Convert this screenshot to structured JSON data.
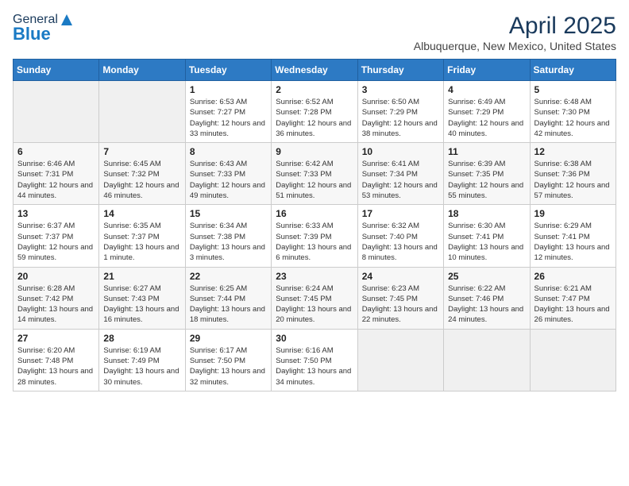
{
  "header": {
    "logo_general": "General",
    "logo_blue": "Blue",
    "title": "April 2025",
    "subtitle": "Albuquerque, New Mexico, United States"
  },
  "weekdays": [
    "Sunday",
    "Monday",
    "Tuesday",
    "Wednesday",
    "Thursday",
    "Friday",
    "Saturday"
  ],
  "weeks": [
    [
      {
        "day": "",
        "info": ""
      },
      {
        "day": "",
        "info": ""
      },
      {
        "day": "1",
        "info": "Sunrise: 6:53 AM\nSunset: 7:27 PM\nDaylight: 12 hours and 33 minutes."
      },
      {
        "day": "2",
        "info": "Sunrise: 6:52 AM\nSunset: 7:28 PM\nDaylight: 12 hours and 36 minutes."
      },
      {
        "day": "3",
        "info": "Sunrise: 6:50 AM\nSunset: 7:29 PM\nDaylight: 12 hours and 38 minutes."
      },
      {
        "day": "4",
        "info": "Sunrise: 6:49 AM\nSunset: 7:29 PM\nDaylight: 12 hours and 40 minutes."
      },
      {
        "day": "5",
        "info": "Sunrise: 6:48 AM\nSunset: 7:30 PM\nDaylight: 12 hours and 42 minutes."
      }
    ],
    [
      {
        "day": "6",
        "info": "Sunrise: 6:46 AM\nSunset: 7:31 PM\nDaylight: 12 hours and 44 minutes."
      },
      {
        "day": "7",
        "info": "Sunrise: 6:45 AM\nSunset: 7:32 PM\nDaylight: 12 hours and 46 minutes."
      },
      {
        "day": "8",
        "info": "Sunrise: 6:43 AM\nSunset: 7:33 PM\nDaylight: 12 hours and 49 minutes."
      },
      {
        "day": "9",
        "info": "Sunrise: 6:42 AM\nSunset: 7:33 PM\nDaylight: 12 hours and 51 minutes."
      },
      {
        "day": "10",
        "info": "Sunrise: 6:41 AM\nSunset: 7:34 PM\nDaylight: 12 hours and 53 minutes."
      },
      {
        "day": "11",
        "info": "Sunrise: 6:39 AM\nSunset: 7:35 PM\nDaylight: 12 hours and 55 minutes."
      },
      {
        "day": "12",
        "info": "Sunrise: 6:38 AM\nSunset: 7:36 PM\nDaylight: 12 hours and 57 minutes."
      }
    ],
    [
      {
        "day": "13",
        "info": "Sunrise: 6:37 AM\nSunset: 7:37 PM\nDaylight: 12 hours and 59 minutes."
      },
      {
        "day": "14",
        "info": "Sunrise: 6:35 AM\nSunset: 7:37 PM\nDaylight: 13 hours and 1 minute."
      },
      {
        "day": "15",
        "info": "Sunrise: 6:34 AM\nSunset: 7:38 PM\nDaylight: 13 hours and 3 minutes."
      },
      {
        "day": "16",
        "info": "Sunrise: 6:33 AM\nSunset: 7:39 PM\nDaylight: 13 hours and 6 minutes."
      },
      {
        "day": "17",
        "info": "Sunrise: 6:32 AM\nSunset: 7:40 PM\nDaylight: 13 hours and 8 minutes."
      },
      {
        "day": "18",
        "info": "Sunrise: 6:30 AM\nSunset: 7:41 PM\nDaylight: 13 hours and 10 minutes."
      },
      {
        "day": "19",
        "info": "Sunrise: 6:29 AM\nSunset: 7:41 PM\nDaylight: 13 hours and 12 minutes."
      }
    ],
    [
      {
        "day": "20",
        "info": "Sunrise: 6:28 AM\nSunset: 7:42 PM\nDaylight: 13 hours and 14 minutes."
      },
      {
        "day": "21",
        "info": "Sunrise: 6:27 AM\nSunset: 7:43 PM\nDaylight: 13 hours and 16 minutes."
      },
      {
        "day": "22",
        "info": "Sunrise: 6:25 AM\nSunset: 7:44 PM\nDaylight: 13 hours and 18 minutes."
      },
      {
        "day": "23",
        "info": "Sunrise: 6:24 AM\nSunset: 7:45 PM\nDaylight: 13 hours and 20 minutes."
      },
      {
        "day": "24",
        "info": "Sunrise: 6:23 AM\nSunset: 7:45 PM\nDaylight: 13 hours and 22 minutes."
      },
      {
        "day": "25",
        "info": "Sunrise: 6:22 AM\nSunset: 7:46 PM\nDaylight: 13 hours and 24 minutes."
      },
      {
        "day": "26",
        "info": "Sunrise: 6:21 AM\nSunset: 7:47 PM\nDaylight: 13 hours and 26 minutes."
      }
    ],
    [
      {
        "day": "27",
        "info": "Sunrise: 6:20 AM\nSunset: 7:48 PM\nDaylight: 13 hours and 28 minutes."
      },
      {
        "day": "28",
        "info": "Sunrise: 6:19 AM\nSunset: 7:49 PM\nDaylight: 13 hours and 30 minutes."
      },
      {
        "day": "29",
        "info": "Sunrise: 6:17 AM\nSunset: 7:50 PM\nDaylight: 13 hours and 32 minutes."
      },
      {
        "day": "30",
        "info": "Sunrise: 6:16 AM\nSunset: 7:50 PM\nDaylight: 13 hours and 34 minutes."
      },
      {
        "day": "",
        "info": ""
      },
      {
        "day": "",
        "info": ""
      },
      {
        "day": "",
        "info": ""
      }
    ]
  ]
}
